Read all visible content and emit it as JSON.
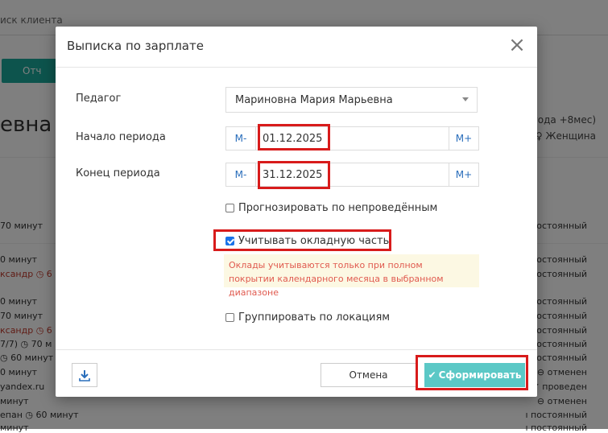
{
  "background": {
    "search_text": "иск клиента",
    "action_button": "Отч",
    "client_name": "евна",
    "client_age": "года +8мес)",
    "client_gender": "♀ Женщина",
    "lines": [
      {
        "text": "70 минут",
        "red": false
      },
      {
        "text": "0 минут",
        "red": false
      },
      {
        "text": "ксандр  ◷ 6",
        "red": true
      },
      {
        "text": "0 минут",
        "red": false
      },
      {
        "text": "70 минут",
        "red": false
      },
      {
        "text": "ксандр  ◷ 6",
        "red": true
      },
      {
        "text": "7/7)  ◷ 70 м",
        "red": false
      },
      {
        "text": "◷ 60 минут",
        "red": false
      },
      {
        "text": "0 минут",
        "red": false
      },
      {
        "text": "yandex.ru",
        "red": false
      },
      {
        "text": "минут",
        "red": false
      },
      {
        "text": "епан   ◷ 60 минут",
        "red": false
      },
      {
        "text": "минут",
        "red": false
      }
    ],
    "statuses": [
      "постоянный",
      "постоянный",
      "постоянный",
      "постоянный",
      "постоянный",
      "постоянный",
      "постоянный",
      "постоянный",
      "⊖ отменен",
      "✔ проведен",
      "⊖ отменен",
      "ı постоянный",
      "ı постоянный"
    ]
  },
  "modal": {
    "title": "Выписка по зарплате",
    "close_symbol": "×",
    "teacher_label": "Педагог",
    "teacher_value": "Мариновна Мария Марьевна",
    "start_label": "Начало периода",
    "start_value": "01.12.2025",
    "end_label": "Конец периода",
    "end_value": "31.12.2025",
    "minus_label": "М-",
    "plus_label": "М+",
    "forecast_label": "Прогнозировать по непроведённым",
    "forecast_checked": false,
    "salary_label": "Учитывать окладную часть",
    "salary_checked": true,
    "salary_note": "Оклады учитываются только при полном покрытии календарного месяца в выбранном диапазоне",
    "group_label": "Группировать по локациям",
    "group_checked": false,
    "cancel_label": "Отмена",
    "submit_icon": "✔",
    "submit_label": "Сформировать"
  },
  "colors": {
    "accent": "#5bc8c6",
    "warning_text": "#e05a4f",
    "warning_bg": "#fcf8e3",
    "highlight": "#d81b1b",
    "link": "#2a6ebb"
  },
  "icons": [
    "download-icon",
    "close-icon",
    "check-icon",
    "chevron-down-icon"
  ]
}
